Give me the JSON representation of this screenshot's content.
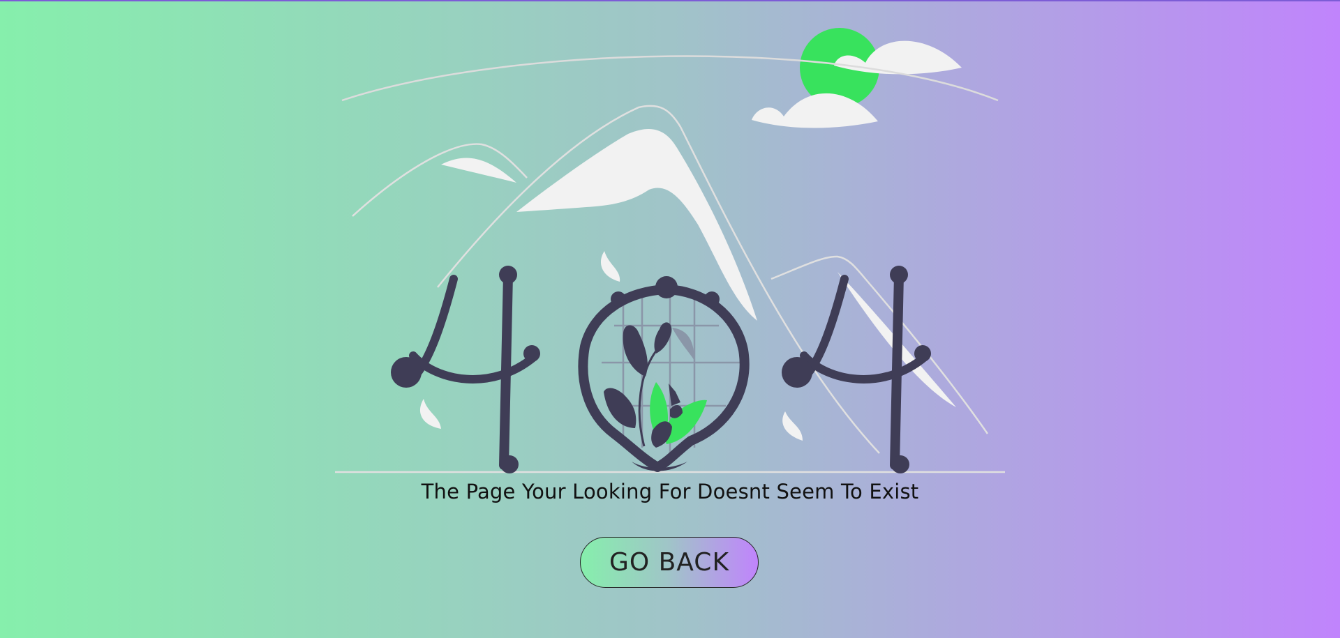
{
  "message": "The Page Your Looking For Doesnt Seem To Exist",
  "button": {
    "label": "GO BACK"
  },
  "illustration": {
    "digits": "404",
    "icons": [
      "mountains",
      "clouds",
      "sun",
      "plant",
      "globe"
    ]
  },
  "colors": {
    "gradient_start": "#86efac",
    "gradient_mid": "#a0c4c8",
    "gradient_end": "#c084fc",
    "ink": "#3f3d56",
    "accent_green": "#38e25d",
    "snow": "#f2f2f2"
  }
}
